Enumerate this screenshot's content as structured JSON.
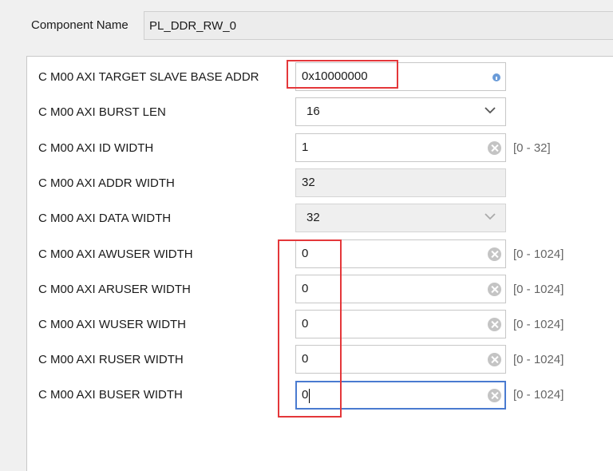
{
  "component": {
    "label": "Component Name",
    "value": "PL_DDR_RW_0"
  },
  "params": [
    {
      "label": "C M00 AXI TARGET SLAVE BASE ADDR",
      "value": "0x10000000"
    },
    {
      "label": "C M00 AXI BURST LEN",
      "value": "16"
    },
    {
      "label": "C M00 AXI ID WIDTH",
      "value": "1",
      "range": "[0 - 32]"
    },
    {
      "label": "C M00 AXI ADDR WIDTH",
      "value": "32"
    },
    {
      "label": "C M00 AXI DATA WIDTH",
      "value": "32"
    },
    {
      "label": "C M00 AXI AWUSER WIDTH",
      "value": "0",
      "range": "[0 - 1024]"
    },
    {
      "label": "C M00 AXI ARUSER WIDTH",
      "value": "0",
      "range": "[0 - 1024]"
    },
    {
      "label": "C M00 AXI WUSER WIDTH",
      "value": "0",
      "range": "[0 - 1024]"
    },
    {
      "label": "C M00 AXI RUSER WIDTH",
      "value": "0",
      "range": "[0 - 1024]"
    },
    {
      "label": "C M00 AXI BUSER WIDTH",
      "value": "0",
      "range": "[0 - 1024]"
    }
  ],
  "icons": {
    "clear": "clear-icon",
    "dropdown": "chevron-down-icon",
    "info": "info-icon"
  },
  "colors": {
    "highlight": "#e4373a",
    "focus": "#4a7bd0"
  }
}
